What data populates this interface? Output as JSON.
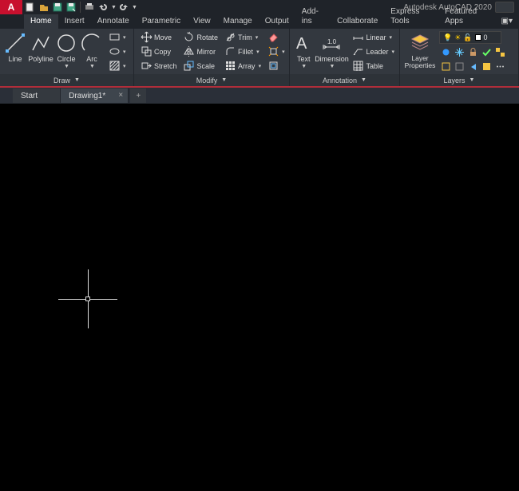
{
  "app": {
    "title": "Autodesk AutoCAD 2020",
    "logo": "A"
  },
  "menus": [
    "Home",
    "Insert",
    "Annotate",
    "Parametric",
    "View",
    "Manage",
    "Output",
    "Add-ins",
    "Collaborate",
    "Express Tools",
    "Featured Apps"
  ],
  "active_menu": 0,
  "ribbon": {
    "draw": {
      "title": "Draw",
      "line": "Line",
      "polyline": "Polyline",
      "circle": "Circle",
      "arc": "Arc"
    },
    "modify": {
      "title": "Modify",
      "move": "Move",
      "copy": "Copy",
      "stretch": "Stretch",
      "rotate": "Rotate",
      "mirror": "Mirror",
      "scale": "Scale",
      "trim": "Trim",
      "fillet": "Fillet",
      "array": "Array"
    },
    "annotation": {
      "title": "Annotation",
      "text": "Text",
      "dimension": "Dimension",
      "linear": "Linear",
      "leader": "Leader",
      "table": "Table"
    },
    "layers": {
      "title": "Layers",
      "props": "Layer\nProperties",
      "current": "0"
    }
  },
  "file_tabs": [
    {
      "label": "Start",
      "active": false,
      "closable": false
    },
    {
      "label": "Drawing1*",
      "active": true,
      "closable": true
    }
  ]
}
